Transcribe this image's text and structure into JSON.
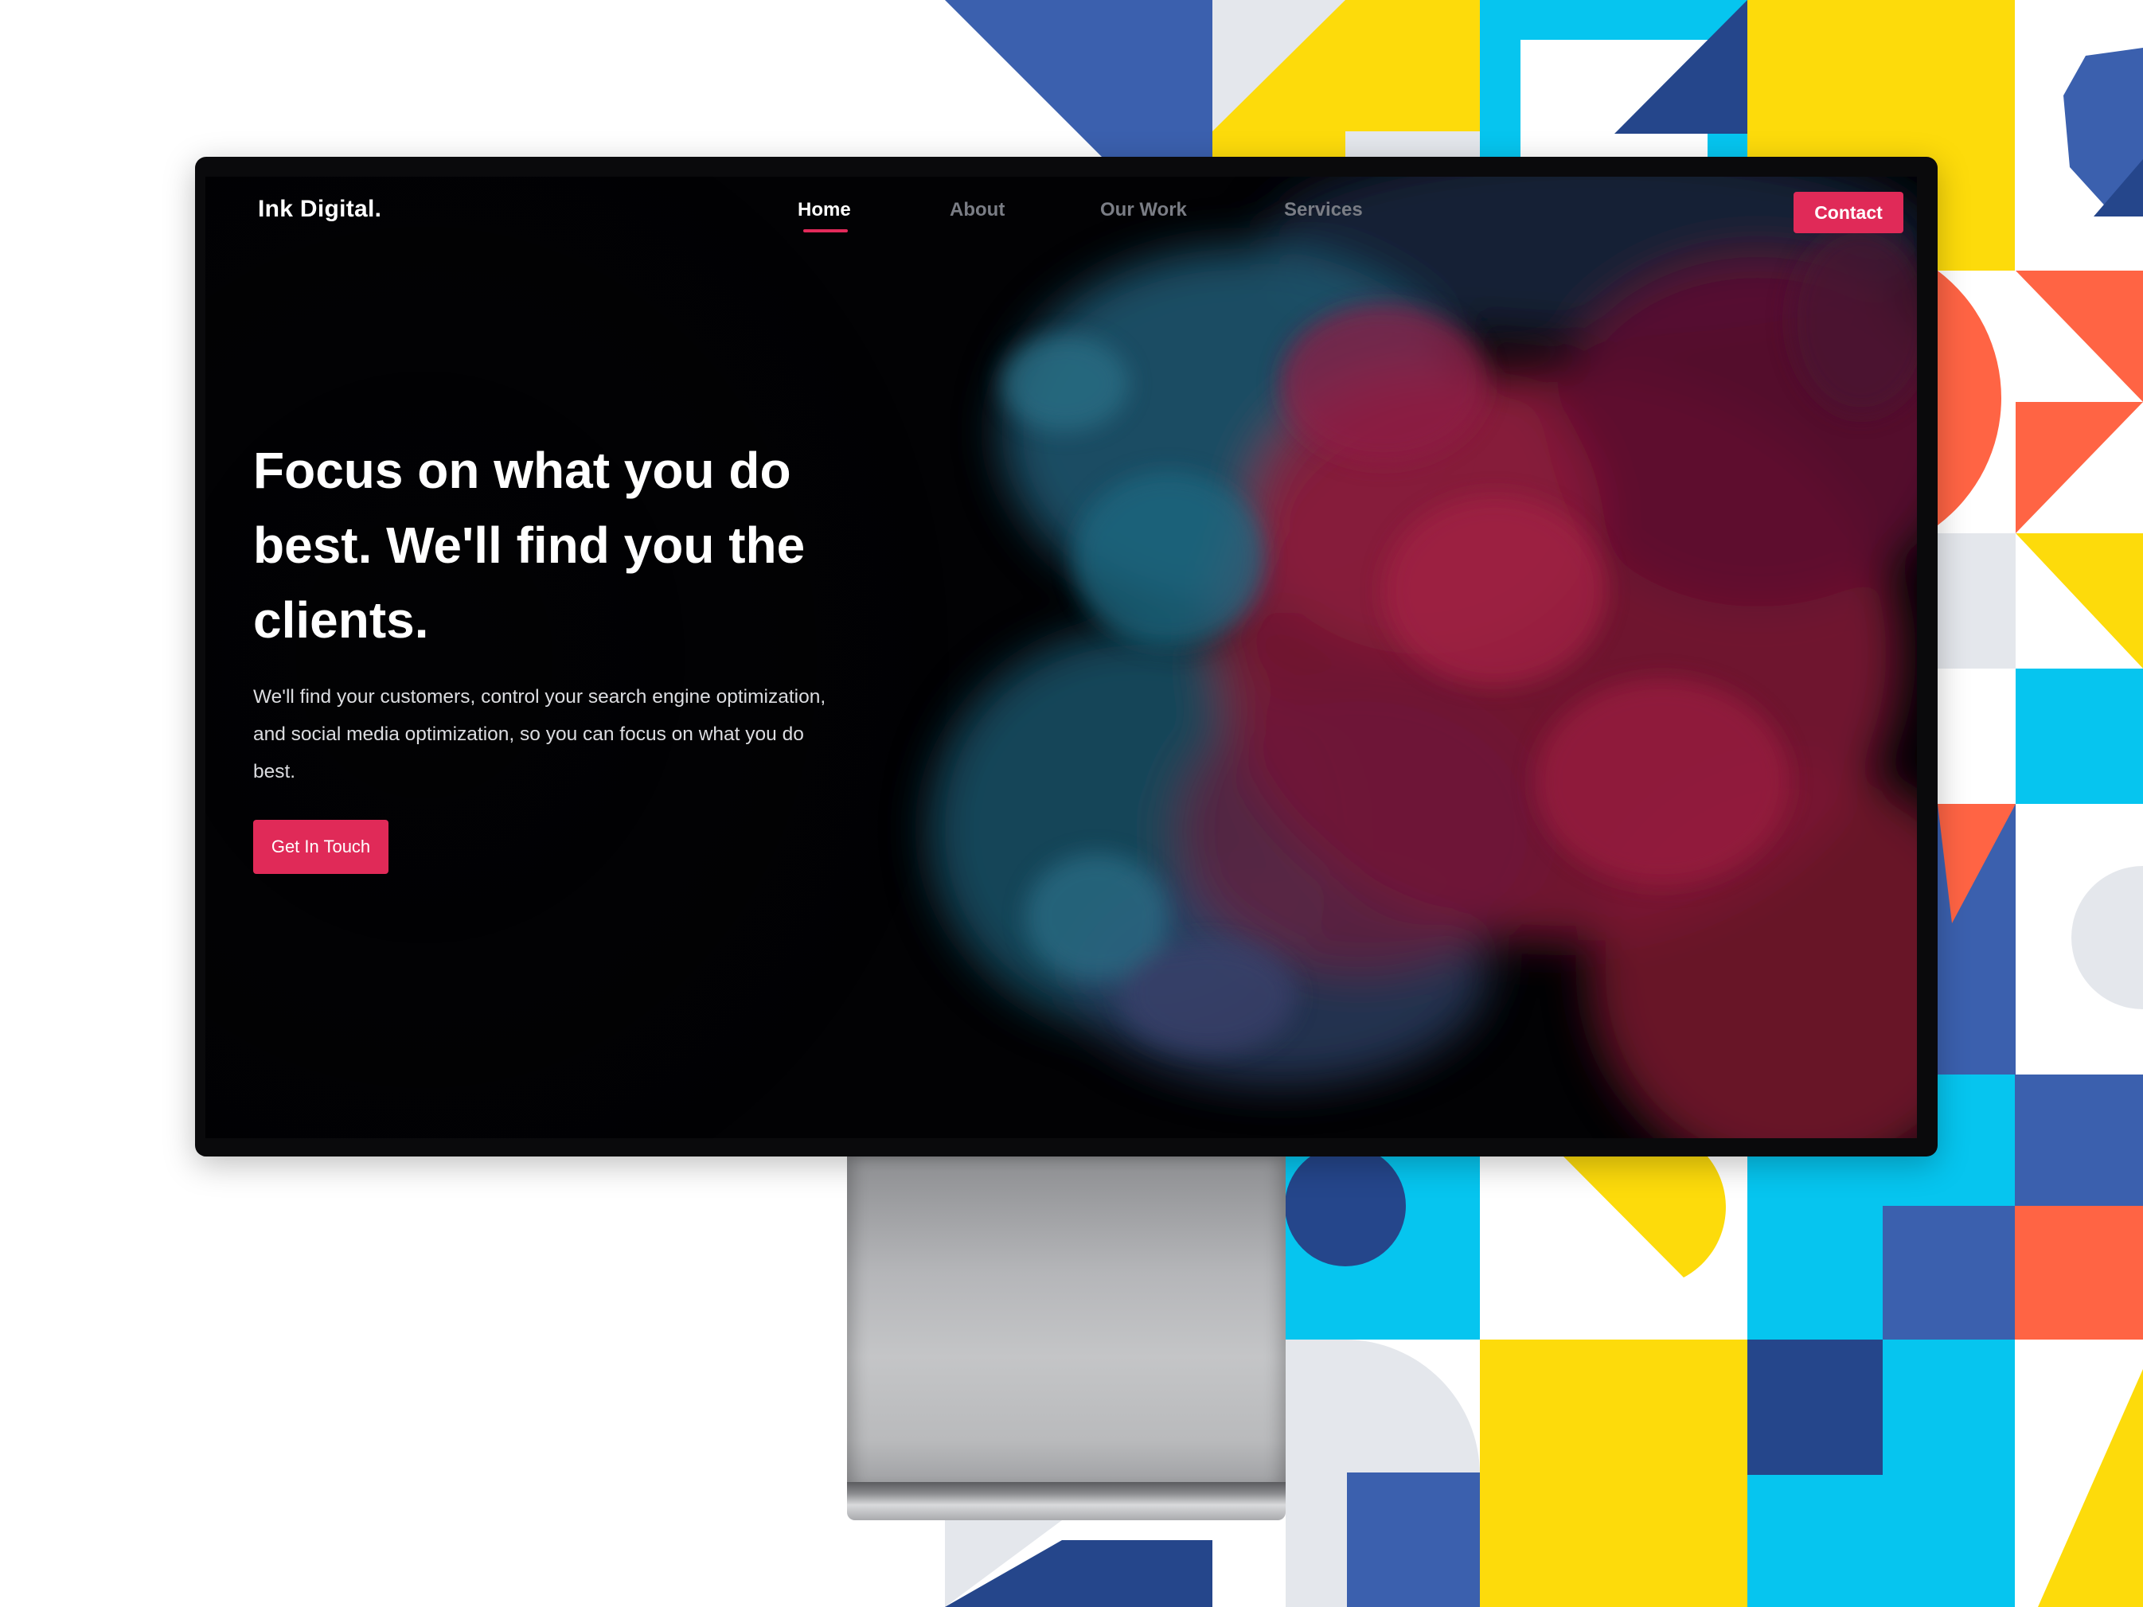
{
  "site": {
    "logo": "Ink Digital.",
    "nav": {
      "home": "Home",
      "about": "About",
      "our_work": "Our Work",
      "services": "Services",
      "contact": "Contact"
    },
    "active_nav": "Home",
    "hero": {
      "title": "Focus on what you do best. We'll find you the clients.",
      "subtitle": "We'll find your customers, control your search engine optimization, and social media optimization, so you can focus on what you do best.",
      "cta": "Get In Touch"
    }
  },
  "colors": {
    "accent": "#e02a58",
    "screen_bg": "#020204",
    "smoke_blue": "#1f5f78",
    "smoke_red": "#8a1838",
    "pattern_blue": "#3b60ae",
    "pattern_navy": "#25468b",
    "pattern_yellow": "#fddb0b",
    "pattern_cyan": "#06c5ef",
    "pattern_orange": "#ff6444",
    "pattern_grey": "#e4e7ec"
  },
  "icons": [
    "geometric-background-pattern",
    "ink-smoke-image"
  ]
}
